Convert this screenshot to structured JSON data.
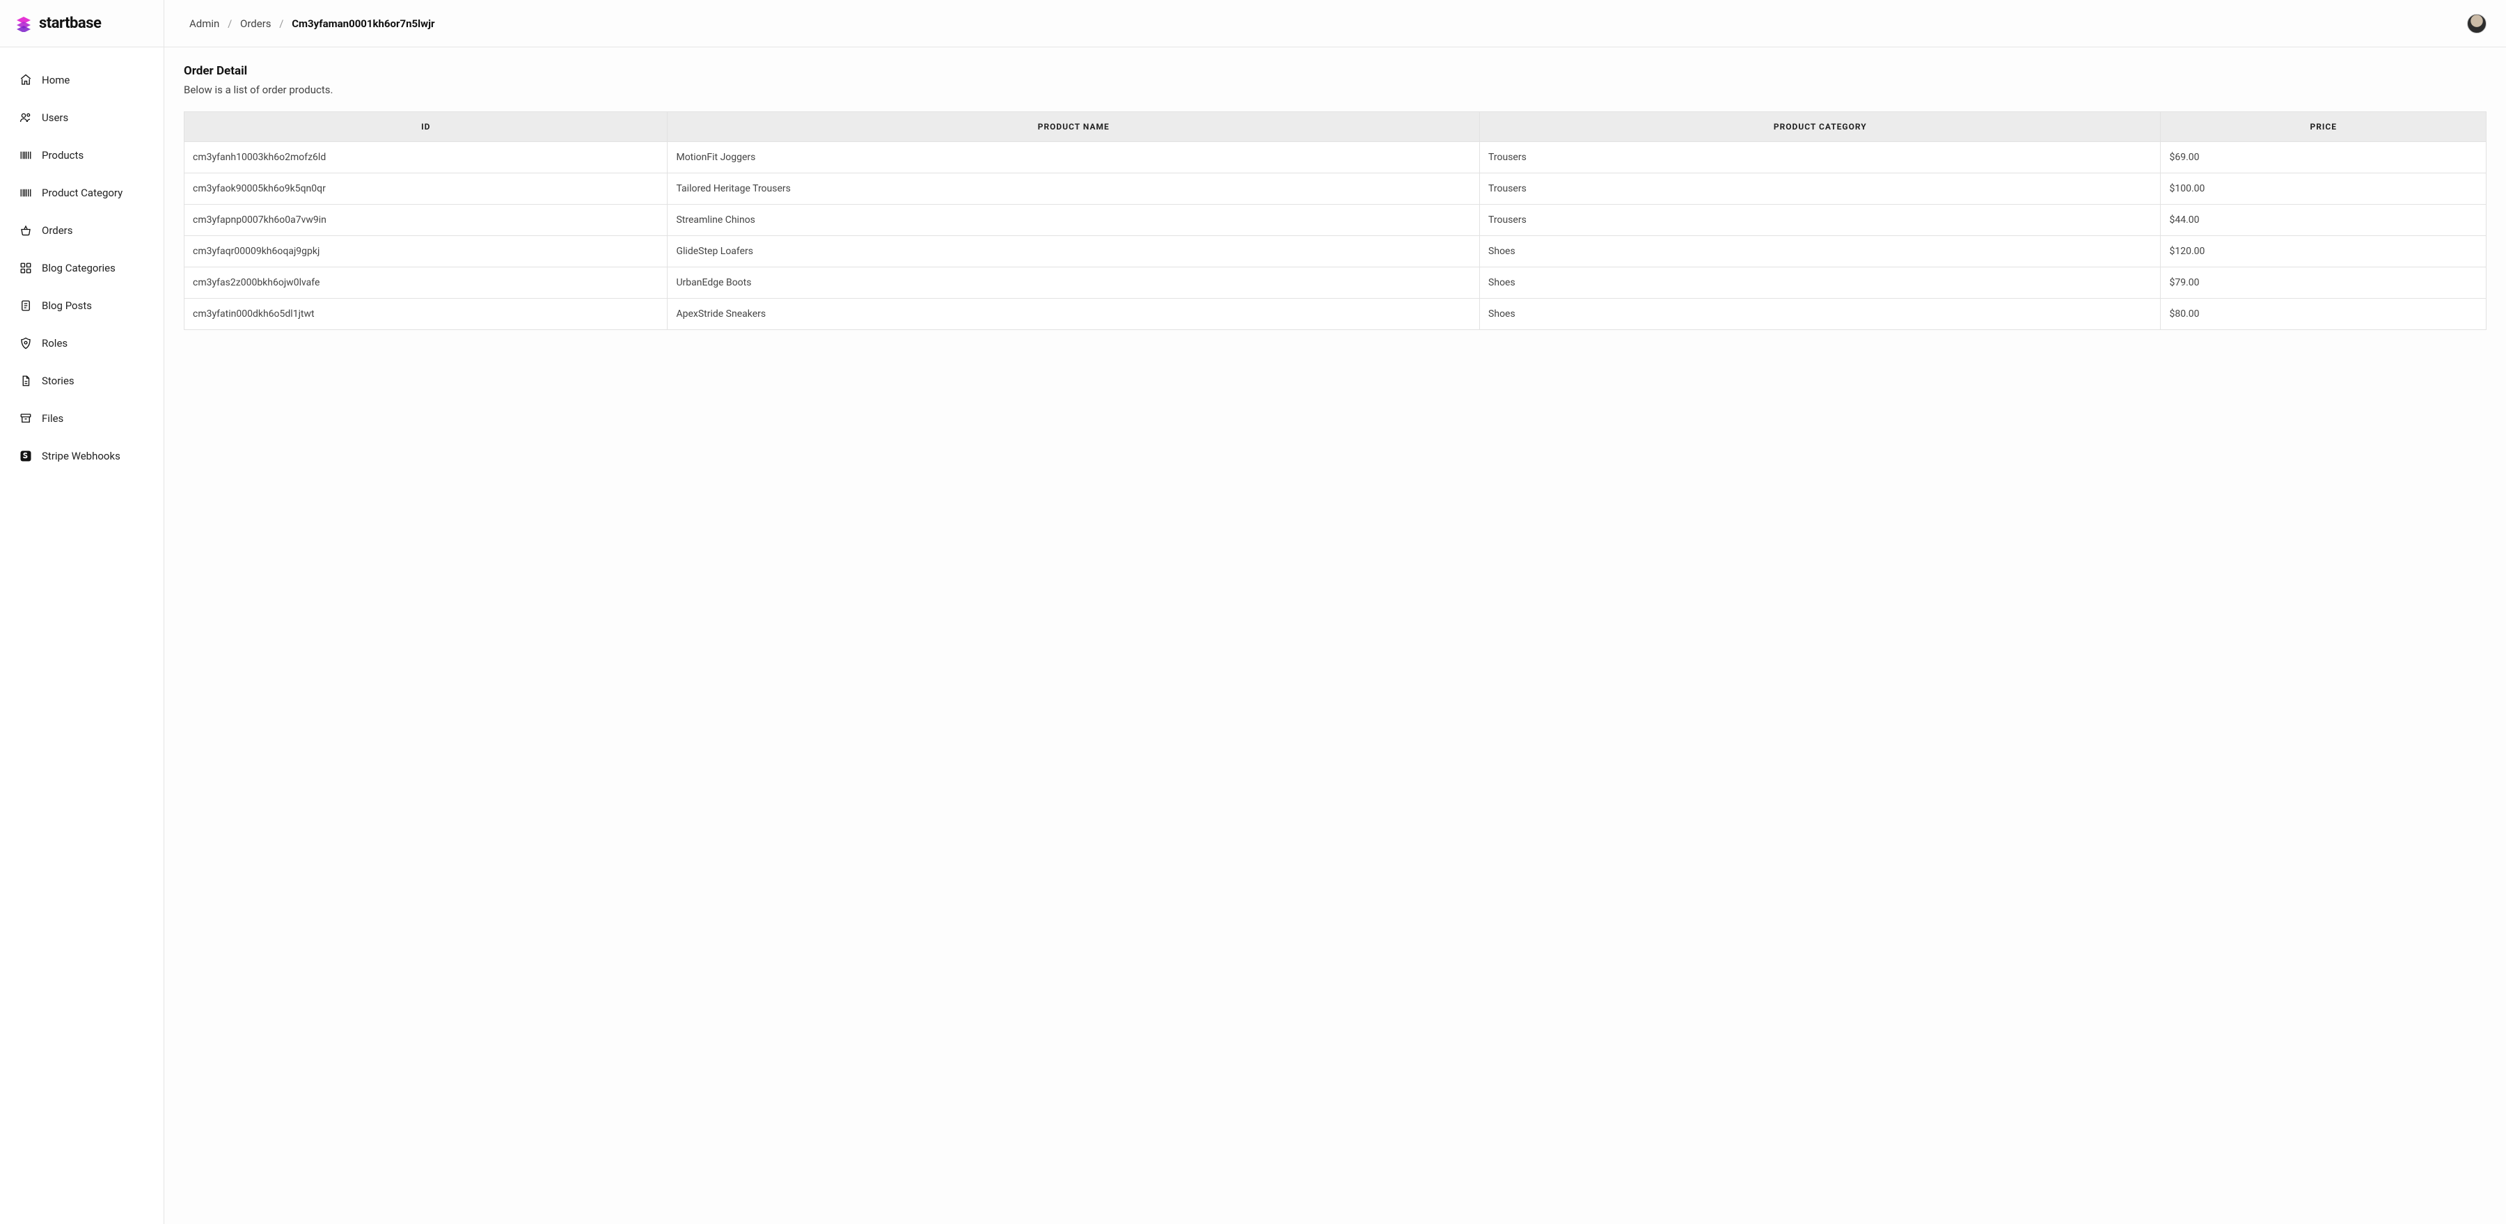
{
  "brand": {
    "name": "startbase"
  },
  "breadcrumb": {
    "items": [
      {
        "label": "Admin"
      },
      {
        "label": "Orders"
      }
    ],
    "current": "Cm3yfaman0001kh6or7n5lwjr"
  },
  "sidebar": {
    "items": [
      {
        "label": "Home",
        "icon": "home-icon"
      },
      {
        "label": "Users",
        "icon": "users-icon"
      },
      {
        "label": "Products",
        "icon": "barcode-icon"
      },
      {
        "label": "Product Category",
        "icon": "barcode-icon"
      },
      {
        "label": "Orders",
        "icon": "basket-icon"
      },
      {
        "label": "Blog Categories",
        "icon": "grid-icon"
      },
      {
        "label": "Blog Posts",
        "icon": "document-icon"
      },
      {
        "label": "Roles",
        "icon": "shield-icon"
      },
      {
        "label": "Stories",
        "icon": "page-icon"
      },
      {
        "label": "Files",
        "icon": "archive-icon"
      },
      {
        "label": "Stripe Webhooks",
        "icon": "stripe-icon"
      }
    ]
  },
  "page": {
    "title": "Order Detail",
    "subtitle": "Below is a list of order products."
  },
  "table": {
    "columns": [
      "ID",
      "PRODUCT NAME",
      "PRODUCT CATEGORY",
      "PRICE"
    ],
    "rows": [
      {
        "id": "cm3yfanh10003kh6o2mofz6ld",
        "name": "MotionFit Joggers",
        "category": "Trousers",
        "price": "$69.00"
      },
      {
        "id": "cm3yfaok90005kh6o9k5qn0qr",
        "name": "Tailored Heritage Trousers",
        "category": "Trousers",
        "price": "$100.00"
      },
      {
        "id": "cm3yfapnp0007kh6o0a7vw9in",
        "name": "Streamline Chinos",
        "category": "Trousers",
        "price": "$44.00"
      },
      {
        "id": "cm3yfaqr00009kh6oqaj9gpkj",
        "name": "GlideStep Loafers",
        "category": "Shoes",
        "price": "$120.00"
      },
      {
        "id": "cm3yfas2z000bkh6ojw0lvafe",
        "name": "UrbanEdge Boots",
        "category": "Shoes",
        "price": "$79.00"
      },
      {
        "id": "cm3yfatin000dkh6o5dl1jtwt",
        "name": "ApexStride Sneakers",
        "category": "Shoes",
        "price": "$80.00"
      }
    ]
  }
}
